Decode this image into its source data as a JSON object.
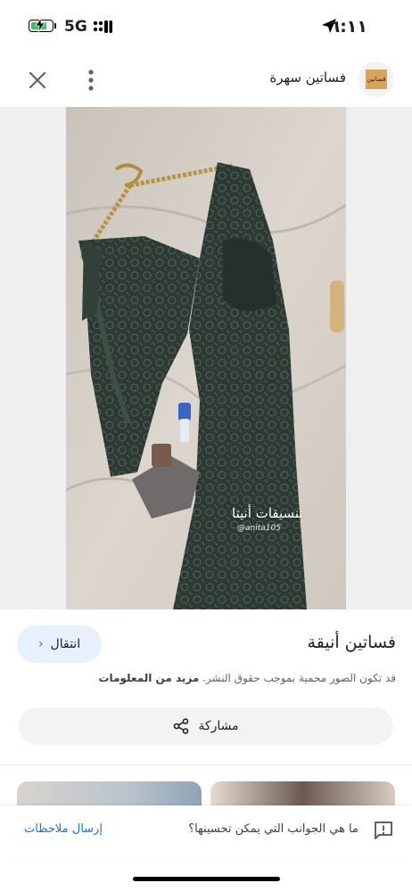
{
  "status_bar": {
    "time": "٦:١١",
    "network": "5G",
    "battery_level": 0.65
  },
  "header": {
    "site_name": "فساتين سهرة",
    "logo_text": "فساتين"
  },
  "image": {
    "watermark_text": "تنسيقات أنيتا",
    "watermark_handle": "@anita105"
  },
  "details": {
    "visit_label": "انتقال",
    "title": "فساتين أنيقة",
    "copyright_text": "قد تكون الصور محمية بموجب حقوق النشر.",
    "more_info_label": "مزيد من المعلومات",
    "share_label": "مشاركة"
  },
  "feedback": {
    "question": "ما هي الجوانب التي يمكن تحسينها؟",
    "send_label": "إرسال ملاحظات"
  },
  "colors": {
    "accent": "#1a73e8",
    "visit_bg": "#e8f0fe",
    "share_bg": "#f1f3f4",
    "dress": "#2c3a33"
  }
}
